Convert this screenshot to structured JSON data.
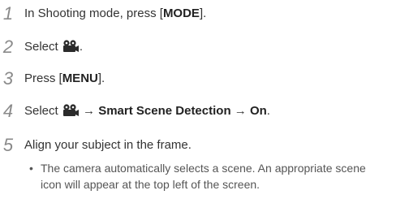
{
  "steps": [
    {
      "number": "1",
      "pre": "In Shooting mode, press [",
      "bold": "MODE",
      "post": "]."
    },
    {
      "number": "2",
      "pre": "Select",
      "post": "."
    },
    {
      "number": "3",
      "pre": "Press [",
      "bold": "MENU",
      "post": "]."
    },
    {
      "number": "4",
      "pre": "Select",
      "arrow1": "→",
      "bold1": "Smart Scene Detection",
      "arrow2": "→",
      "bold2": "On",
      "post": "."
    },
    {
      "number": "5",
      "text": "Align your subject in the frame."
    }
  ],
  "bullet": {
    "marker": "•",
    "text": "The camera automatically selects a scene. An appropriate scene icon will appear at the top left of the screen."
  },
  "icons": {
    "movie_mode": "movie-camera-icon"
  }
}
